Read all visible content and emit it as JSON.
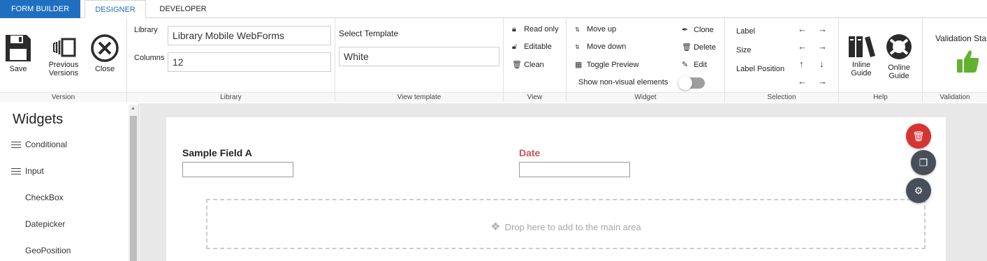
{
  "tabs": [
    {
      "label": "FORM BUILDER"
    },
    {
      "label": "DESIGNER"
    },
    {
      "label": "DEVELOPER"
    }
  ],
  "ribbon": {
    "version": {
      "footer": "Version",
      "save": "Save",
      "previous_versions_1": "Previous",
      "previous_versions_2": "Versions",
      "close": "Close"
    },
    "library": {
      "footer": "Library",
      "library_label": "Library",
      "library_value": "Library Mobile WebForms",
      "columns_label": "Columns",
      "columns_value": "12"
    },
    "view_template": {
      "footer": "View template",
      "label": "Select Template",
      "value": "White"
    },
    "view": {
      "footer": "View",
      "read_only": "Read only",
      "editable": "Editable",
      "clean": "Clean"
    },
    "widget": {
      "footer": "Widget",
      "move_up": "Move up",
      "move_down": "Move down",
      "toggle_preview": "Toggle Preview",
      "show_non_visual": "Show non-visual elements",
      "clone": "Clone",
      "delete": "Delete",
      "edit": "Edit",
      "show_non_visual_on": false
    },
    "selection": {
      "footer": "Selection",
      "label": "Label",
      "size": "Size",
      "label_position": "Label Position"
    },
    "help": {
      "footer": "Help",
      "inline_1": "Inline",
      "inline_2": "Guide",
      "online_1": "Online",
      "online_2": "Guide"
    },
    "validation": {
      "footer": "Validation",
      "title": "Validation Sta"
    }
  },
  "sidebar": {
    "title": "Widgets",
    "items": [
      {
        "label": "Conditional",
        "group": true
      },
      {
        "label": "Input",
        "group": true
      },
      {
        "label": "CheckBox",
        "group": false
      },
      {
        "label": "Datepicker",
        "group": false
      },
      {
        "label": "GeoPosition",
        "group": false
      }
    ]
  },
  "form": {
    "field_a": "Sample Field A",
    "field_b": "Date",
    "drop_text": "Drop here to add to the main area"
  },
  "colors": {
    "brand_blue": "#1f6fc1",
    "date_label": "#c9565a",
    "fab_delete": "#d63431",
    "fab_dark": "#47505a",
    "thumbs_green": "#63b22f"
  },
  "icons": {
    "save": "floppy-disk-icon",
    "previous_versions": "versions-icon",
    "close": "close-circle-icon",
    "inline_guide": "books-icon",
    "online_guide": "lifebuoy-icon",
    "validation": "thumbs-up-icon"
  }
}
